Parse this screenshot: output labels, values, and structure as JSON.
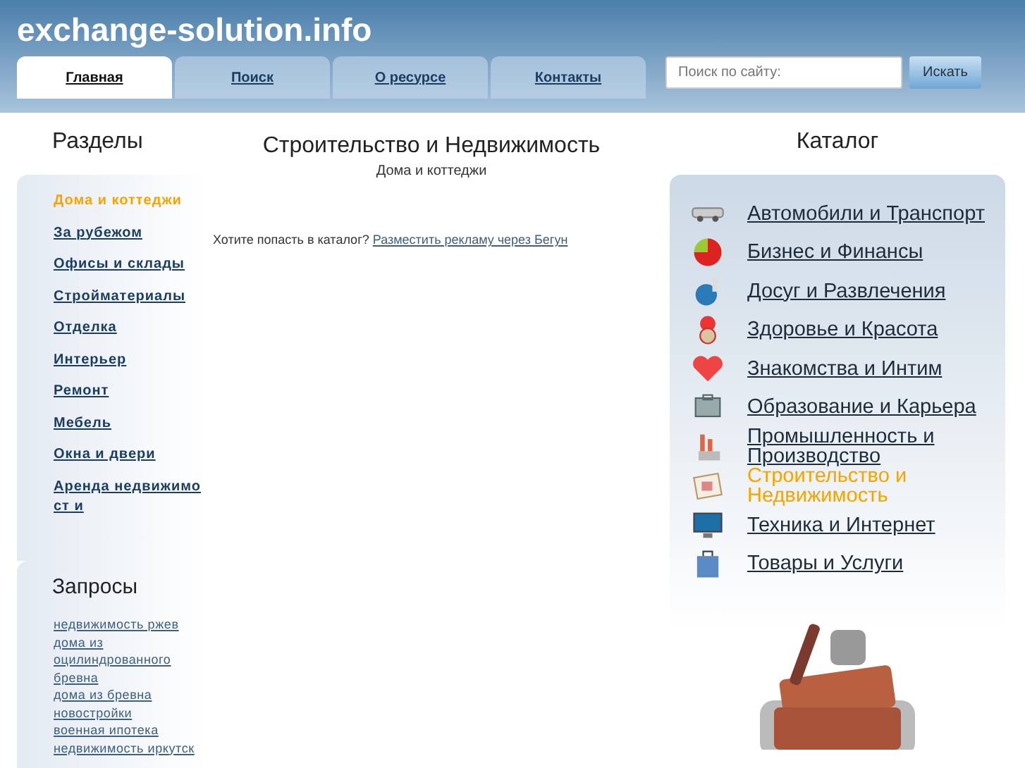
{
  "site": {
    "title": "exchange-solution.info"
  },
  "tabs": [
    {
      "label": "Главная",
      "selected": true
    },
    {
      "label": "Поиск",
      "selected": false
    },
    {
      "label": "О ресурсе",
      "selected": false
    },
    {
      "label": "Контакты",
      "selected": false
    }
  ],
  "search": {
    "placeholder": "Поиск по сайту:",
    "button": "Искать"
  },
  "sections": {
    "title": "Разделы",
    "items": [
      {
        "label": "Дома и коттеджи",
        "selected": true
      },
      {
        "label": "За рубежом",
        "selected": false
      },
      {
        "label": "Офисы и склады",
        "selected": false
      },
      {
        "label": "Стройматериалы",
        "selected": false
      },
      {
        "label": "Отделка",
        "selected": false
      },
      {
        "label": "Интерьер",
        "selected": false
      },
      {
        "label": "Ремонт",
        "selected": false
      },
      {
        "label": "Мебель",
        "selected": false
      },
      {
        "label": "Окна и двери",
        "selected": false
      },
      {
        "label": "Аренда недвижимост и",
        "selected": false
      }
    ]
  },
  "queries": {
    "title": "Запросы",
    "items": [
      "недвижимость ржев",
      "дома из оцилиндрованного бревна",
      "дома из бревна",
      "новостройки",
      "военная ипотека",
      "недвижимость иркутск"
    ]
  },
  "content": {
    "title": "Строительство и Недвижимость",
    "subtitle": "Дома и коттеджи",
    "prompt": "Хотите попасть в каталог?",
    "link": "Разместить рекламу через Бегун"
  },
  "catalog": {
    "title": "Каталог",
    "items": [
      {
        "label": "Автомобили и Транспорт",
        "selected": false
      },
      {
        "label": "Бизнес и Финансы",
        "selected": false
      },
      {
        "label": "Досуг и Развлечения",
        "selected": false
      },
      {
        "label": "Здоровье и Красота",
        "selected": false
      },
      {
        "label": "Знакомства и Интим",
        "selected": false
      },
      {
        "label": "Образование и Карьера",
        "selected": false
      },
      {
        "label": "Промышленность и Производство",
        "selected": false
      },
      {
        "label": "Строительство и Недвижимость",
        "selected": true
      },
      {
        "label": "Техника и Интернет",
        "selected": false
      },
      {
        "label": "Товары и Услуги",
        "selected": false
      }
    ]
  }
}
